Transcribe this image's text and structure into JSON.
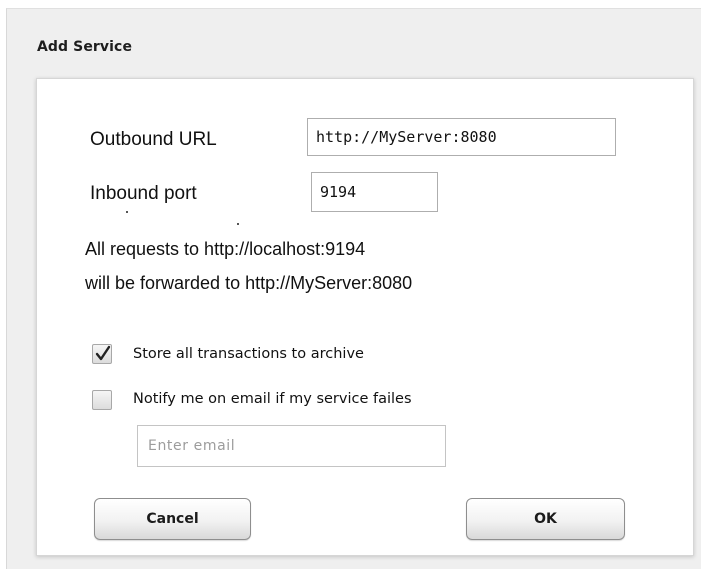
{
  "dialog": {
    "title": "Add Service"
  },
  "form": {
    "outbound_url_label": "Outbound URL",
    "outbound_url_value": "http://MyServer:8080",
    "inbound_port_label": "Inbound port",
    "inbound_port_value": "9194",
    "info_line_1": "All requests to  http://localhost:9194",
    "info_line_2": "will be forwarded to  http://MyServer:8080"
  },
  "options": {
    "store_archive": {
      "label": "Store all transactions to archive",
      "checked": true
    },
    "notify_email": {
      "label": "Notify me on email if my service failes",
      "checked": false
    },
    "email_placeholder": "Enter email",
    "email_value": ""
  },
  "buttons": {
    "cancel_label": "Cancel",
    "ok_label": "OK"
  },
  "icons": {
    "checkmark": "check-icon"
  }
}
